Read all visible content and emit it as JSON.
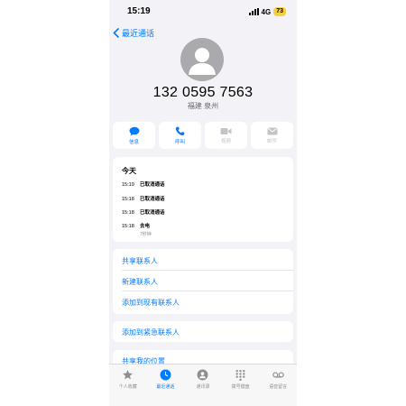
{
  "status": {
    "time": "15:19",
    "network": "4G",
    "battery": "73"
  },
  "nav": {
    "back_label": "最近通话"
  },
  "contact": {
    "number": "132 0595 7563",
    "location": "福建 泉州"
  },
  "actions": [
    {
      "label": "信息",
      "icon": "message-icon",
      "enabled": true
    },
    {
      "label": "呼叫",
      "icon": "phone-icon",
      "enabled": true
    },
    {
      "label": "视频",
      "icon": "video-icon",
      "enabled": false
    },
    {
      "label": "邮件",
      "icon": "mail-icon",
      "enabled": false
    }
  ],
  "recent_calls": {
    "header": "今天",
    "calls": [
      {
        "time": "15:19",
        "status": "已取消通话",
        "detail": ""
      },
      {
        "time": "15:18",
        "status": "已取消通话",
        "detail": ""
      },
      {
        "time": "15:18",
        "status": "已取消通话",
        "detail": ""
      },
      {
        "time": "15:18",
        "status": "去电",
        "detail": "7秒钟"
      }
    ]
  },
  "links": {
    "share_contact": "共享联系人",
    "new_contact": "新建联系人",
    "add_existing": "添加到现有联系人",
    "add_emergency": "添加到紧急联系人",
    "share_location": "共享我的位置"
  },
  "tabs": [
    {
      "label": "个人收藏",
      "icon": "star-icon",
      "active": false
    },
    {
      "label": "最近通话",
      "icon": "clock-icon",
      "active": true
    },
    {
      "label": "通讯录",
      "icon": "person-icon",
      "active": false
    },
    {
      "label": "拨号键盘",
      "icon": "keypad-icon",
      "active": false
    },
    {
      "label": "语音留言",
      "icon": "voicemail-icon",
      "active": false
    }
  ],
  "colors": {
    "accent": "#007aff",
    "background": "#f2f2f7",
    "battery": "#f4d03f",
    "avatar": "#a9a9ae",
    "disabled": "#c4c4c8"
  }
}
